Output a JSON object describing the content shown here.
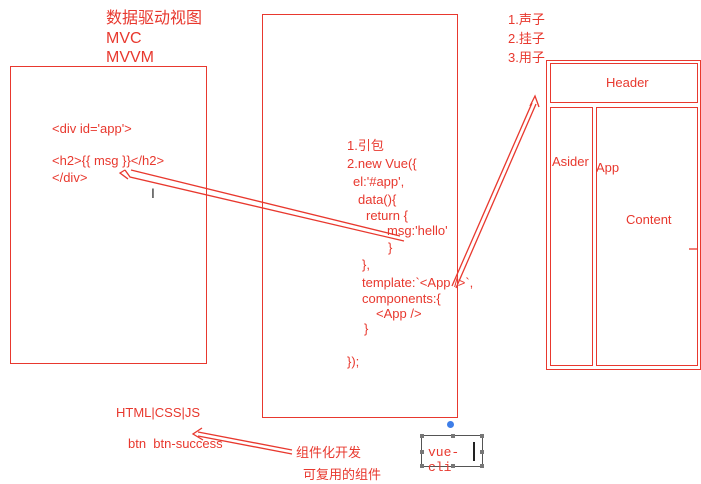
{
  "colors": {
    "ink": "#e8382e",
    "selection_dot": "#3e7ee8"
  },
  "heading": {
    "line1": "数据驱动视图",
    "line2": "MVC",
    "line3": "MVVM"
  },
  "left_panel": {
    "code_line1": "<div id='app'>",
    "code_line2": "<h2>{{ msg }}</h2>",
    "code_line3": "</div>"
  },
  "middle_panel": {
    "lines": [
      "1.引包",
      "2.new Vue({",
      "  el:'#app',",
      "  data(){",
      "    return {",
      "      msg:'hello'",
      "      }",
      "  },",
      "  template:`<App />`,",
      "  components:{",
      "      <App />",
      "    }",
      "",
      "});"
    ]
  },
  "top_right_list": [
    "1.声子",
    "2.挂子",
    "3.用子"
  ],
  "layout_diagram": {
    "header": "Header",
    "aside": "Asider",
    "app": "App",
    "content": "Content"
  },
  "bottom_left": {
    "tech": "HTML|CSS|JS",
    "classes": "btn  btn-success"
  },
  "bottom_notes": {
    "line1": "组件化开发",
    "line2": "可复用的组件"
  },
  "text_box": {
    "value": "vue-cli"
  },
  "icons": {
    "cursor": "text-cursor-icon"
  }
}
